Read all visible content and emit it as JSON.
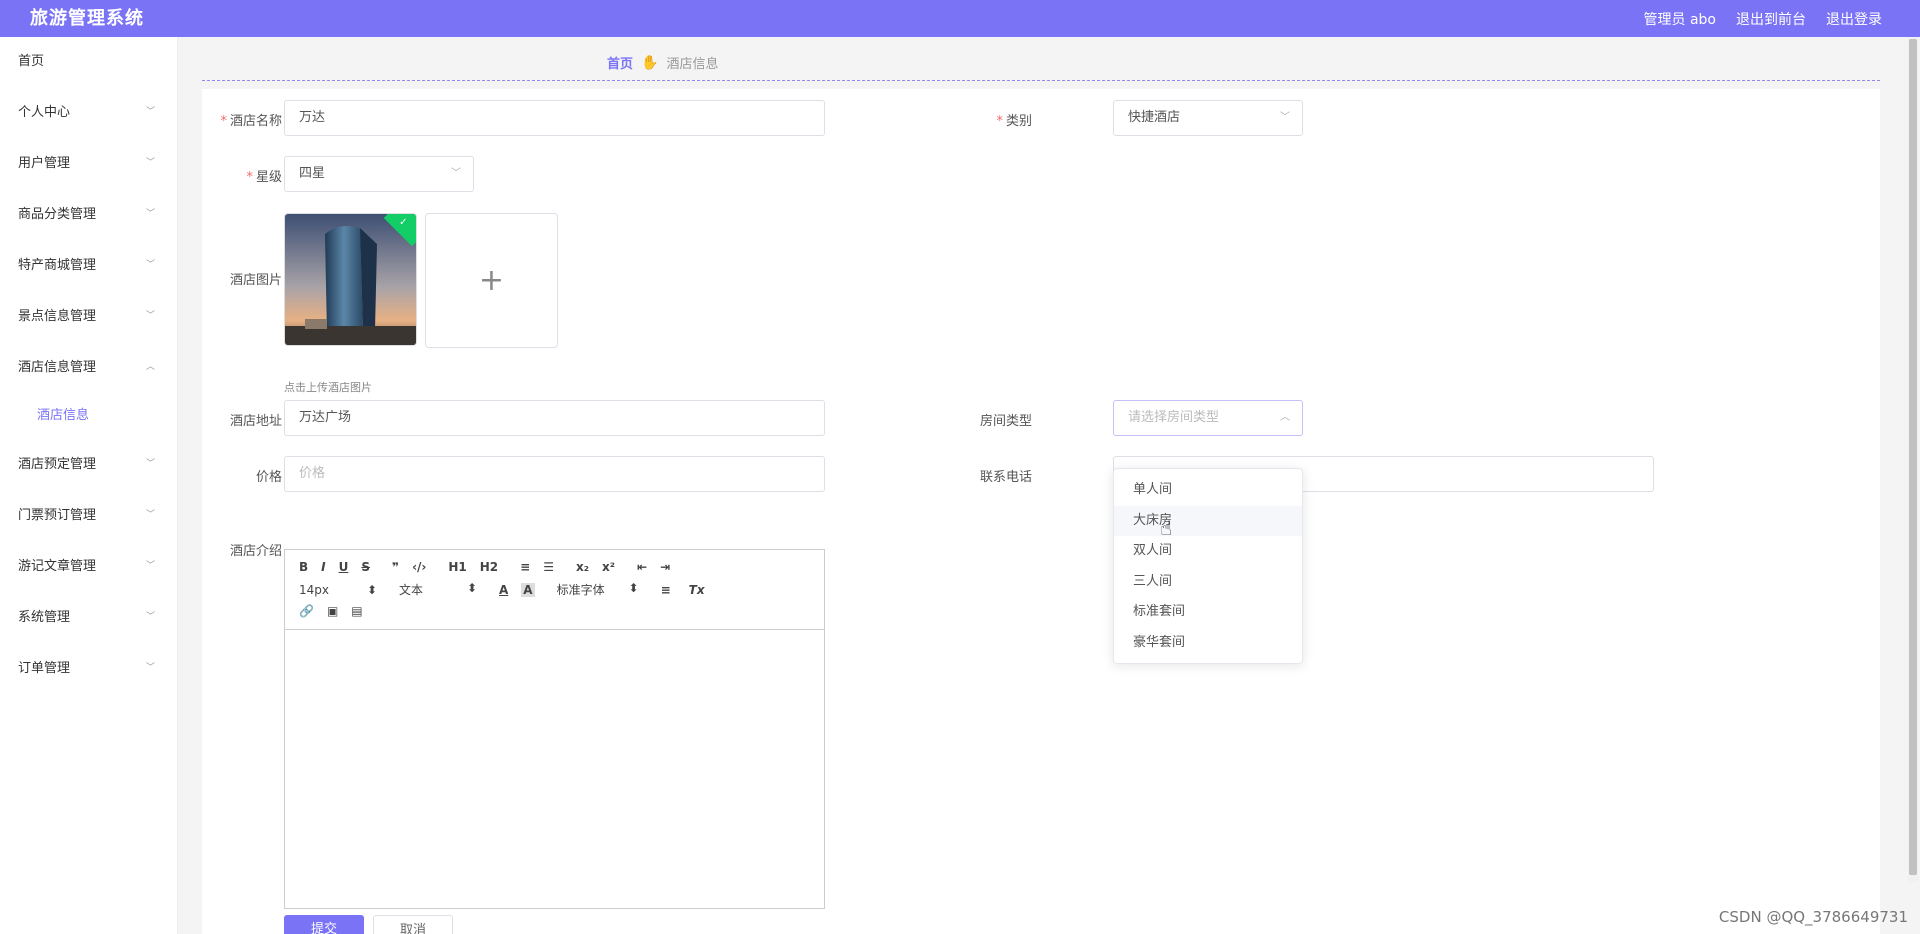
{
  "header": {
    "title": "旅游管理系统",
    "admin_label": "管理员 abo",
    "to_frontend": "退出到前台",
    "logout": "退出登录"
  },
  "sidebar": {
    "items": [
      {
        "label": "首页",
        "icon": "none"
      },
      {
        "label": "个人中心",
        "icon": "chevron-down-icon"
      },
      {
        "label": "用户管理",
        "icon": "chevron-down-icon"
      },
      {
        "label": "商品分类管理",
        "icon": "chevron-down-icon"
      },
      {
        "label": "特产商城管理",
        "icon": "chevron-down-icon"
      },
      {
        "label": "景点信息管理",
        "icon": "chevron-down-icon"
      },
      {
        "label": "酒店信息管理",
        "icon": "chevron-up-icon"
      },
      {
        "label": "酒店预定管理",
        "icon": "chevron-down-icon"
      },
      {
        "label": "门票预订管理",
        "icon": "chevron-down-icon"
      },
      {
        "label": "游记文章管理",
        "icon": "chevron-down-icon"
      },
      {
        "label": "系统管理",
        "icon": "chevron-down-icon"
      },
      {
        "label": "订单管理",
        "icon": "chevron-down-icon"
      }
    ],
    "sub_item": "酒店信息"
  },
  "breadcrumb": {
    "home": "首页",
    "current": "酒店信息"
  },
  "form": {
    "hotel_name": {
      "label": "酒店名称",
      "value": "万达"
    },
    "category": {
      "label": "类别",
      "value": "快捷酒店"
    },
    "star": {
      "label": "星级",
      "value": "四星"
    },
    "image": {
      "label": "酒店图片",
      "hint": "点击上传酒店图片",
      "add_symbol": "+"
    },
    "address": {
      "label": "酒店地址",
      "value": "万达广场"
    },
    "room_type": {
      "label": "房间类型",
      "placeholder": "请选择房间类型"
    },
    "price": {
      "label": "价格",
      "placeholder": "价格"
    },
    "phone": {
      "label": "联系电话",
      "value": ""
    },
    "intro": {
      "label": "酒店介绍"
    },
    "submit": "提交",
    "cancel": "取消"
  },
  "editor": {
    "size": "14px",
    "header": "文本",
    "font": "标准字体",
    "row1": [
      "B",
      "I",
      "U",
      "S",
      "❞",
      "‹/›",
      "H1",
      "H2",
      "≡",
      "☰",
      "x₂",
      "x²",
      "⇤",
      "⇥"
    ],
    "row2_tail": [
      "A",
      "A",
      "≡",
      "Tx"
    ],
    "row3": [
      "🔗",
      "▣",
      "▤"
    ]
  },
  "dropdown": {
    "options": [
      "单人间",
      "大床房",
      "双人间",
      "三人间",
      "标准套间",
      "豪华套间"
    ],
    "hover_index": 1
  },
  "watermark": "CSDN @QQ_3786649731",
  "colors": {
    "accent": "#7b73f6",
    "required": "#f56c6c",
    "success": "#13ce66"
  }
}
